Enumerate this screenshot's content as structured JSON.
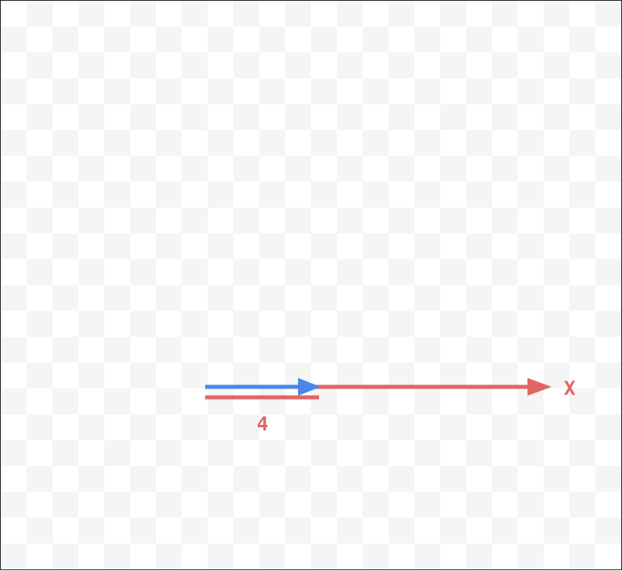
{
  "colors": {
    "axis": "#e06666",
    "vector": "#4a86e8",
    "measure": "#e06666"
  },
  "axis": {
    "label": "X"
  },
  "vector": {
    "length": 4
  },
  "measure": {
    "label": "4"
  }
}
